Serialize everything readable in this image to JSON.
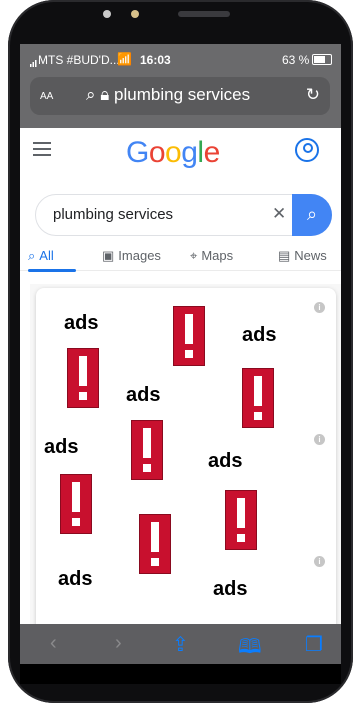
{
  "status_bar": {
    "carrier": "MTS #BUD'D...",
    "time": "16:03",
    "battery": "63 %"
  },
  "url_bar": {
    "text_size_label": "AA",
    "url": "plumbing services"
  },
  "google": {
    "logo_letters": [
      "G",
      "o",
      "o",
      "g",
      "l",
      "e"
    ],
    "search_query": "plumbing services",
    "tabs": [
      {
        "label": "All"
      },
      {
        "label": "Images"
      },
      {
        "label": "Maps"
      },
      {
        "label": "News"
      }
    ]
  },
  "results": {
    "ad_label": "ads",
    "info_glyph": "i"
  },
  "icons": [
    "signal-icon",
    "wifi-icon",
    "battery-icon",
    "lock-icon",
    "search-icon",
    "reload-icon",
    "menu-icon",
    "account-icon",
    "clear-icon",
    "images-icon",
    "maps-icon",
    "news-icon",
    "warning-icon",
    "info-icon",
    "back-icon",
    "forward-icon",
    "share-icon",
    "bookmarks-icon",
    "tabs-icon"
  ],
  "colors": {
    "google_blue": "#4285f4",
    "google_red": "#ea4335",
    "google_yellow": "#fbbc05",
    "google_green": "#34a853",
    "warning_red": "#c8102e",
    "safari_chrome_gray": "#6a6a6c"
  }
}
